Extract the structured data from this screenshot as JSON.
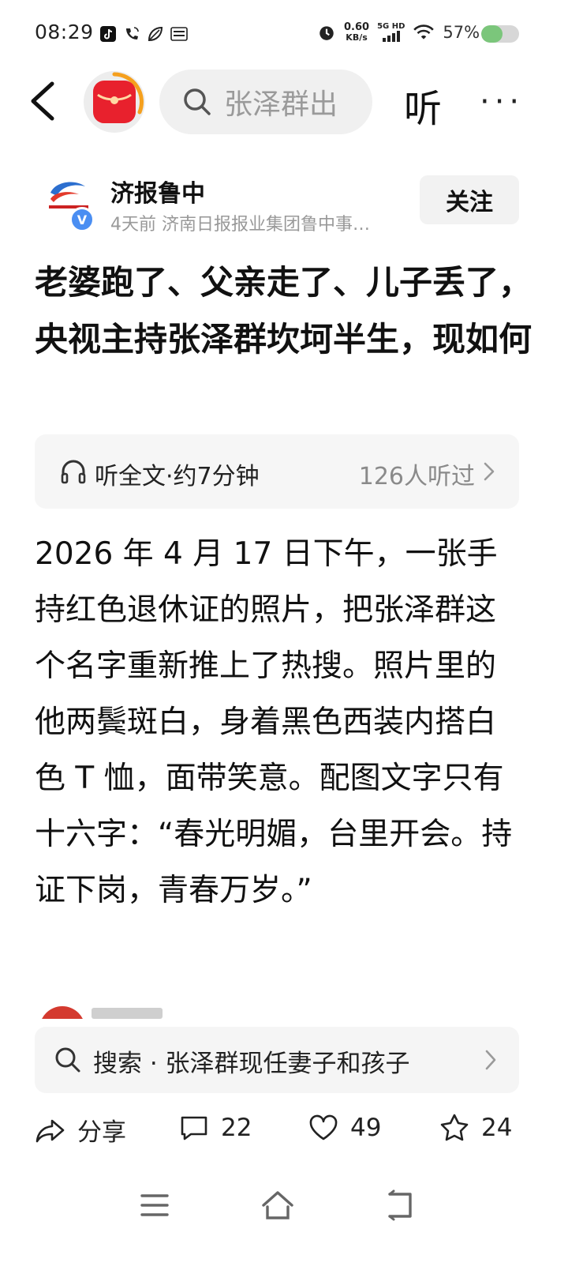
{
  "status_bar": {
    "time": "08:29",
    "net_speed_value": "0.60",
    "net_speed_unit": "KB/s",
    "net_type": "5G HD",
    "battery_percent": "57%",
    "battery_level": 0.57,
    "app_icons": [
      "tiktok-icon",
      "phone-wifi-icon",
      "leaf-icon",
      "toutiao-icon"
    ],
    "right_icons": [
      "alarm-icon",
      "signal-icon",
      "wifi-icon"
    ]
  },
  "top_nav": {
    "search_text": "张泽群出",
    "listen_label": "听",
    "more_label": "···"
  },
  "author": {
    "name": "济报鲁中",
    "verified_mark": "V",
    "meta": "4天前  济南日报报业集团鲁中事…",
    "follow_label": "关注"
  },
  "article": {
    "title": "老婆跑了、父亲走了、儿子丢了，央视主持张泽群坎坷半生，现如何",
    "listen_label": "听全文·约7分钟",
    "listen_count": "126人听过",
    "body": "2026 年 4 月 17 日下午，一张手持红色退休证的照片，把张泽群这个名字重新推上了热搜。照片里的他两鬓斑白，身着黑色西装内搭白色 T 恤，面带笑意。配图文字只有十六字：“春光明媚，台里开会。持证下岗，青春万岁。”"
  },
  "search_suggestion": {
    "text": "搜索 · 张泽群现任妻子和孩子"
  },
  "actions": {
    "share_label": "分享",
    "comment_count": "22",
    "like_count": "49",
    "favorite_count": "24"
  },
  "colors": {
    "accent_red": "#e8212d",
    "verified_blue": "#4a8ef2",
    "battery_green": "#7bc67b"
  }
}
